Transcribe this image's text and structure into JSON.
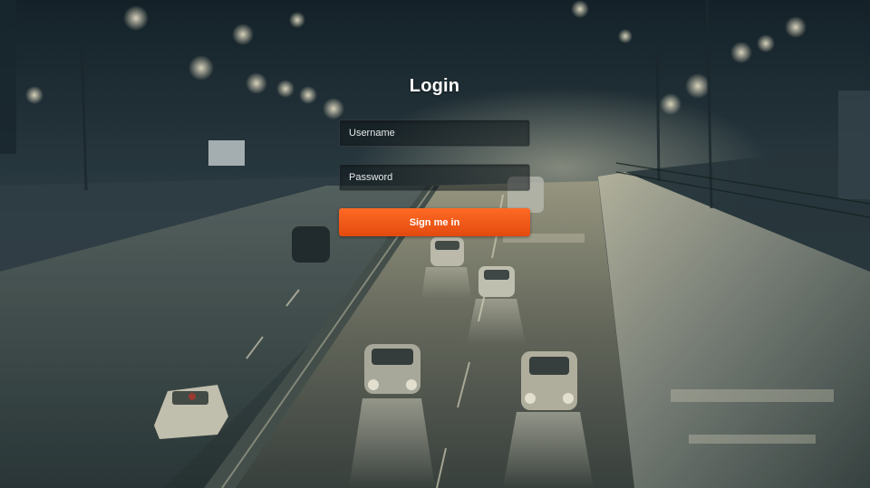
{
  "login": {
    "title": "Login",
    "username_placeholder": "Username",
    "password_placeholder": "Password",
    "submit_label": "Sign me in"
  },
  "colors": {
    "accent": "#f05a1a",
    "title_text": "#ffffff",
    "background_tint": "#1c2a2f"
  }
}
